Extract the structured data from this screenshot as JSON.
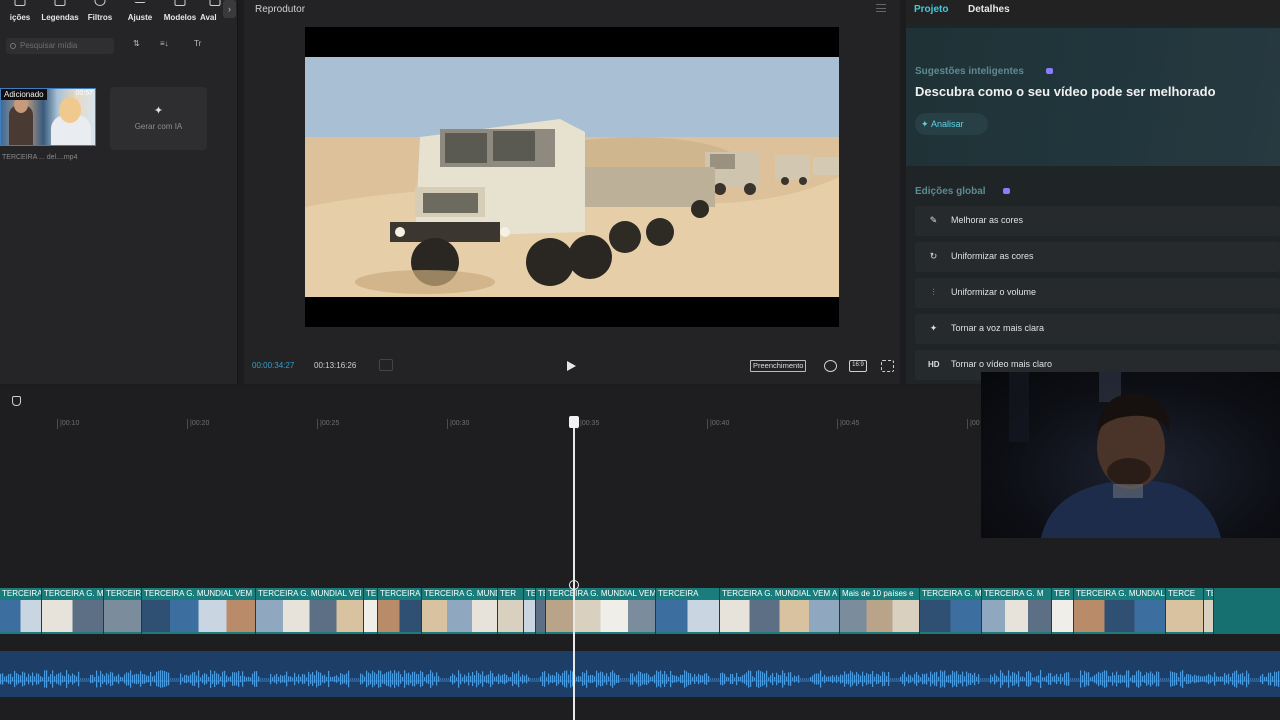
{
  "media_panel": {
    "tools": [
      {
        "label": "ições",
        "icon": "transitions-icon"
      },
      {
        "label": "Legendas",
        "icon": "captions-icon"
      },
      {
        "label": "Filtros",
        "icon": "filters-icon"
      },
      {
        "label": "Ajuste",
        "icon": "adjust-icon"
      },
      {
        "label": "Modelos",
        "icon": "templates-icon"
      },
      {
        "label": "Aval",
        "icon": "avatar-icon"
      }
    ],
    "search_placeholder": "Pesquisar mídia",
    "sort_label": "⇅",
    "filter_label": "≡↓",
    "type_label": "Tr",
    "clip": {
      "badge": "Adicionado",
      "duration": "00:57",
      "filename": "TERCEIRA ... del....mp4"
    },
    "generate_ai_label": "Gerar com IA"
  },
  "player": {
    "title": "Reprodutor",
    "current_time": "00:00:34:27",
    "total_time": "00:13:16:26",
    "fill_label": "Preenchimento",
    "ratio_label": "16:9"
  },
  "right_panel": {
    "tabs": [
      "Projeto",
      "Detalhes"
    ],
    "active_tab": "Projeto",
    "smart_title": "Sugestões inteligentes",
    "smart_desc": "Descubra como o seu vídeo pode ser melhorado",
    "analyze_label": "Analisar",
    "global_title": "Edições global",
    "global_items": [
      {
        "label": "Melhorar as cores",
        "icon": "enhance-colors-icon"
      },
      {
        "label": "Uniformizar as cores",
        "icon": "match-colors-icon"
      },
      {
        "label": "Uniformizar o volume",
        "icon": "volume-icon"
      },
      {
        "label": "Tornar a voz mais clara",
        "icon": "voice-icon"
      },
      {
        "label": "Tornar o vídeo mais claro",
        "icon": "hd-icon"
      }
    ],
    "accent": "#3ecbe0",
    "badge_color": "#8a7cff"
  },
  "timeline": {
    "ticks": [
      "|00:10",
      "|00:20",
      "|00:25",
      "|00:30",
      "|00:35",
      "|00:40",
      "|00:45",
      "|00"
    ],
    "clips": [
      {
        "title": "TERCEIRA G. MUNDI"
      },
      {
        "title": "TERCEIRA G. M"
      },
      {
        "title": "TERCEIRA"
      },
      {
        "title": "TERCEIRA G. MUNDIAL VEM"
      },
      {
        "title": "TERCEIRA G. MUNDIAL VEI"
      },
      {
        "title": "TE"
      },
      {
        "title": "TERCEIRA"
      },
      {
        "title": "TERCEIRA G. MUNDIAL V"
      },
      {
        "title": "TER"
      },
      {
        "title": "TER"
      },
      {
        "title": "TE"
      },
      {
        "title": "TERCEIRA G. MUNDIAL VEM"
      },
      {
        "title": "TERCEIRA"
      },
      {
        "title": "TERCEIRA G. MUNDIAL VEM A"
      },
      {
        "title": "Mais de 10 países e"
      },
      {
        "title": "TERCEIRA G. M"
      },
      {
        "title": "TERCEIRA G. M"
      },
      {
        "title": "TER"
      },
      {
        "title": "TERCEIRA G. MUNDIAL"
      },
      {
        "title": "TERCE"
      },
      {
        "title": "TERCE"
      }
    ],
    "track_color": "#1a7d7b",
    "audio_color": "#1d3e66"
  }
}
